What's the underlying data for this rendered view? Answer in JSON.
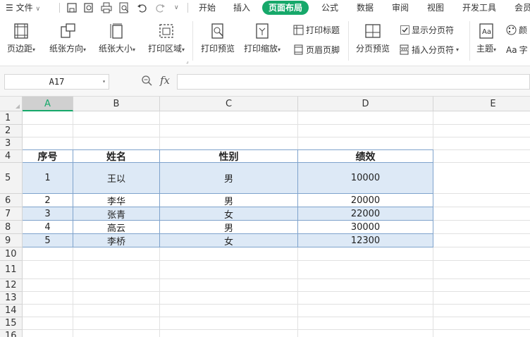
{
  "menubar": {
    "menu_label": "文件",
    "tabs": [
      "开始",
      "插入",
      "页面布局",
      "公式",
      "数据",
      "审阅",
      "视图",
      "开发工具",
      "会员"
    ],
    "active_tab": "页面布局"
  },
  "ribbon": {
    "margins": "页边距",
    "orientation": "纸张方向",
    "size": "纸张大小",
    "print_area": "打印区域",
    "print_preview": "打印预览",
    "print_scale": "打印缩放",
    "print_titles": "打印标题",
    "header_footer": "页眉页脚",
    "page_break_preview": "分页预览",
    "show_page_breaks": "显示分页符",
    "insert_page_break": "插入分页符",
    "theme": "主题",
    "colors": "颜",
    "fonts": "字"
  },
  "formula_bar": {
    "name_box": "A17",
    "fx": "fx",
    "formula": ""
  },
  "columns": [
    "A",
    "B",
    "C",
    "D",
    "E"
  ],
  "selected_column": "A",
  "rows": [
    "1",
    "2",
    "3",
    "4",
    "5",
    "6",
    "7",
    "8",
    "9",
    "10",
    "11",
    "12",
    "13",
    "14",
    "15",
    "16"
  ],
  "table": {
    "headers": [
      "序号",
      "姓名",
      "性别",
      "绩效"
    ],
    "data": [
      [
        "1",
        "王以",
        "男",
        "10000"
      ],
      [
        "2",
        "李华",
        "男",
        "20000"
      ],
      [
        "3",
        "张青",
        "女",
        "22000"
      ],
      [
        "4",
        "高云",
        "男",
        "30000"
      ],
      [
        "5",
        "李桥",
        "女",
        "12300"
      ]
    ]
  },
  "colors": {
    "accent": "#16a86a",
    "band": "#dde9f6",
    "table_border": "#7fa3cc"
  }
}
